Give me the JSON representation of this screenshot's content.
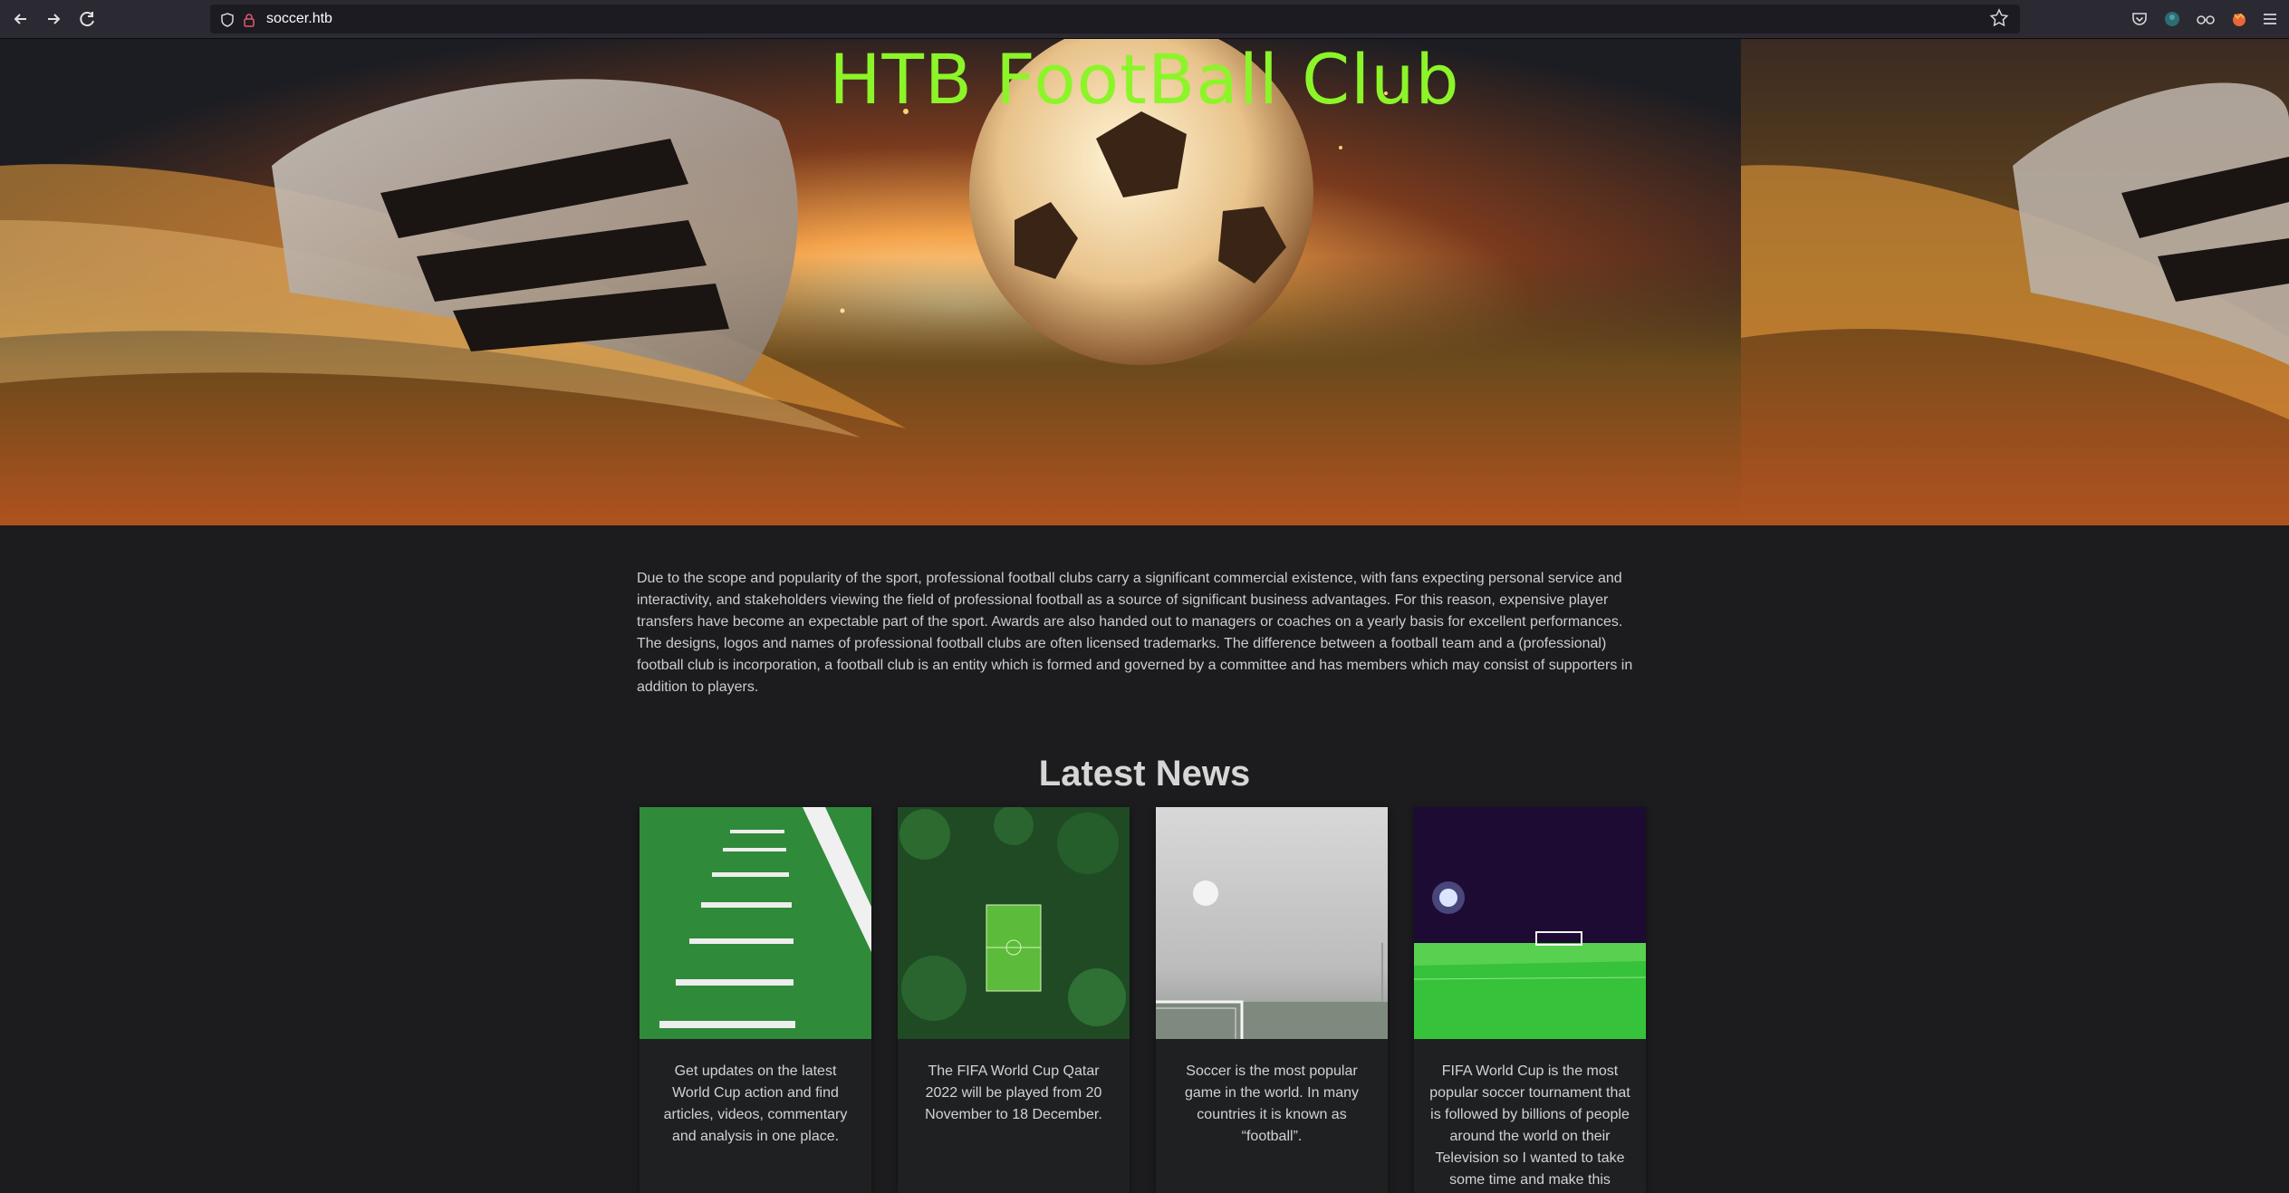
{
  "browser": {
    "url": "soccer.htb",
    "icons": [
      "back-arrow-icon",
      "forward-arrow-icon",
      "reload-icon",
      "shield-icon",
      "lock-icon",
      "star-icon",
      "pocket-icon",
      "account-icon",
      "extension-icon",
      "firefox-view-icon",
      "menu-icon"
    ]
  },
  "hero": {
    "title": "HTB FootBall Club"
  },
  "intro": {
    "text": "Due to the scope and popularity of the sport, professional football clubs carry a significant commercial existence, with fans expecting personal service and interactivity, and stakeholders viewing the field of professional football as a source of significant business advantages. For this reason, expensive player transfers have become an expectable part of the sport. Awards are also handed out to managers or coaches on a yearly basis for excellent performances. The designs, logos and names of professional football clubs are often licensed trademarks. The difference between a football team and a (professional) football club is incorporation, a football club is an entity which is formed and governed by a committee and has members which may consist of supporters in addition to players."
  },
  "news": {
    "heading": "Latest News",
    "cards": [
      {
        "text": "Get updates on the latest World Cup action and find articles, videos, commentary and analysis in one place."
      },
      {
        "text": "The FIFA World Cup Qatar 2022 will be played from 20 November to 18 December."
      },
      {
        "text": "Soccer is the most popular game in the world. In many countries it is known as “football”."
      },
      {
        "text": "FIFA World Cup is the most popular soccer tournament that is followed by billions of people around the world on their Television so I wanted to take some time and make this"
      }
    ]
  }
}
